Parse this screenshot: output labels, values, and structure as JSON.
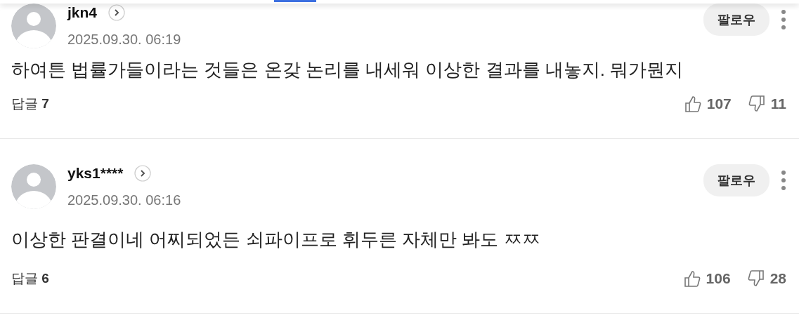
{
  "comments": [
    {
      "username": "jkn4",
      "date": "2025.09.30. 06:19",
      "text": "하여튼 법률가들이라는 것들은 온갖 논리를 내세워 이상한 결과를 내놓지. 뭐가뭔지",
      "reply_label": "답글",
      "reply_count": "7",
      "likes": "107",
      "dislikes": "11",
      "follow_label": "팔로우"
    },
    {
      "username": "yks1****",
      "date": "2025.09.30. 06:16",
      "text": "이상한 판결이네 어찌되었든 쇠파이프로 휘두른 자체만 봐도 ㅉㅉ",
      "reply_label": "답글",
      "reply_count": "6",
      "likes": "106",
      "dislikes": "28",
      "follow_label": "팔로우"
    }
  ]
}
